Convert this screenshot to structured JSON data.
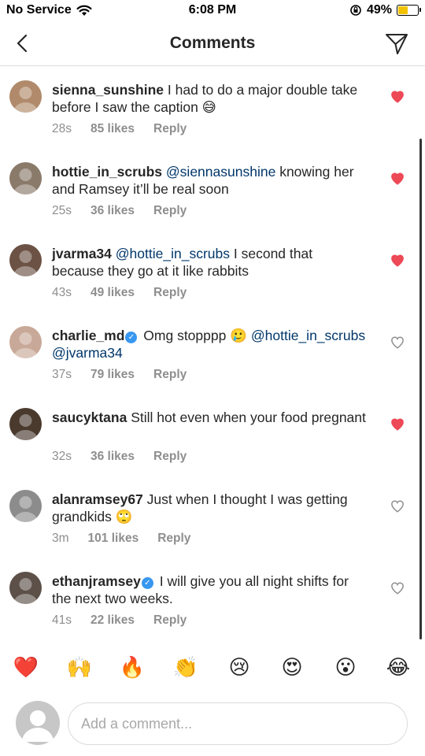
{
  "status_bar": {
    "carrier": "No Service",
    "time": "6:08 PM",
    "battery_percent": "49%",
    "battery_level": 0.49
  },
  "header": {
    "title": "Comments"
  },
  "comments": [
    {
      "username": "sienna_sunshine",
      "verified": false,
      "mentions": "",
      "text": "I had to do a major double take before I saw the caption 😅",
      "time": "28s",
      "likes": "85 likes",
      "reply": "Reply",
      "liked": true
    },
    {
      "username": "hottie_in_scrubs",
      "verified": false,
      "mentions": "@siennasunshine",
      "text": "knowing her and Ramsey it’ll be real soon",
      "time": "25s",
      "likes": "36 likes",
      "reply": "Reply",
      "liked": true
    },
    {
      "username": "jvarma34",
      "verified": false,
      "mentions": "@hottie_in_scrubs",
      "text": "I second that because they go at it like rabbits",
      "time": "43s",
      "likes": "49 likes",
      "reply": "Reply",
      "liked": true
    },
    {
      "username": "charlie_md",
      "verified": true,
      "mentions": "",
      "text": "Omg stopppp 🥲",
      "trailing_mentions": "@hottie_in_scrubs @jvarma34",
      "time": "37s",
      "likes": "79 likes",
      "reply": "Reply",
      "liked": false
    },
    {
      "username": "saucyktana",
      "verified": false,
      "mentions": "",
      "text": "Still hot even when your food pregnant",
      "time": "32s",
      "likes": "36 likes",
      "reply": "Reply",
      "liked": true
    },
    {
      "username": "alanramsey67",
      "verified": false,
      "mentions": "",
      "text": "Just when I thought I was getting grandkids 🙄",
      "time": "3m",
      "likes": "101 likes",
      "reply": "Reply",
      "liked": false
    },
    {
      "username": "ethanjramsey",
      "verified": true,
      "mentions": "",
      "text": "I will give you all night shifts for the next two weeks.",
      "time": "41s",
      "likes": "22 likes",
      "reply": "Reply",
      "liked": false
    }
  ],
  "emoji_bar": [
    "❤️",
    "🙌",
    "🔥",
    "👏",
    "😢",
    "😍",
    "😮",
    "😂"
  ],
  "comment_input": {
    "placeholder": "Add a comment..."
  },
  "colors": {
    "heart_liked": "#ed4956",
    "heart_unliked": "#8e8e8e",
    "mention": "#00376b",
    "meta": "#8e8e8e",
    "verified": "#3897f0"
  }
}
